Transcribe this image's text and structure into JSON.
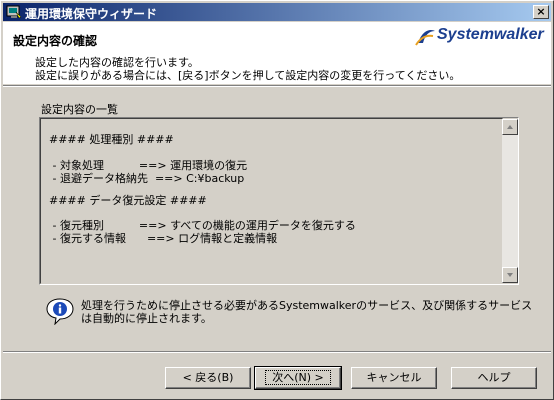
{
  "window": {
    "title": "運用環境保守ウィザード",
    "close_glyph": "×"
  },
  "header": {
    "title": "設定内容の確認",
    "description_line1": "設定した内容の確認を行います。",
    "description_line2": "設定に誤りがある場合には、[戻る]ボタンを押して設定内容の変更を行ってください。",
    "logo_text": "Systemwalker"
  },
  "content": {
    "list_label": "設定内容の一覧",
    "lines": [
      "#### 処理種別 ####",
      " - 対象処理          ==> 運用環境の復元",
      " - 退避データ格納先  ==> C:¥backup",
      "#### データ復元設定 ####",
      " - 復元種別          ==> すべての機能の運用データを復元する",
      " - 復元する情報      ==> ログ情報と定義情報"
    ]
  },
  "info": {
    "line1": "処理を行うために停止させる必要があるSystemwalkerのサービス、及び関係するサービス",
    "line2": "は自動的に停止されます。"
  },
  "buttons": {
    "back": "< 戻る(B)",
    "next": "次へ(N) >",
    "cancel": "キャンセル",
    "help": "ヘルプ"
  },
  "colors": {
    "title_bar_start": "#0a246a",
    "title_bar_end": "#a6caf0",
    "logo": "#1c3f8f",
    "dialog_face": "#d4d0c8"
  }
}
